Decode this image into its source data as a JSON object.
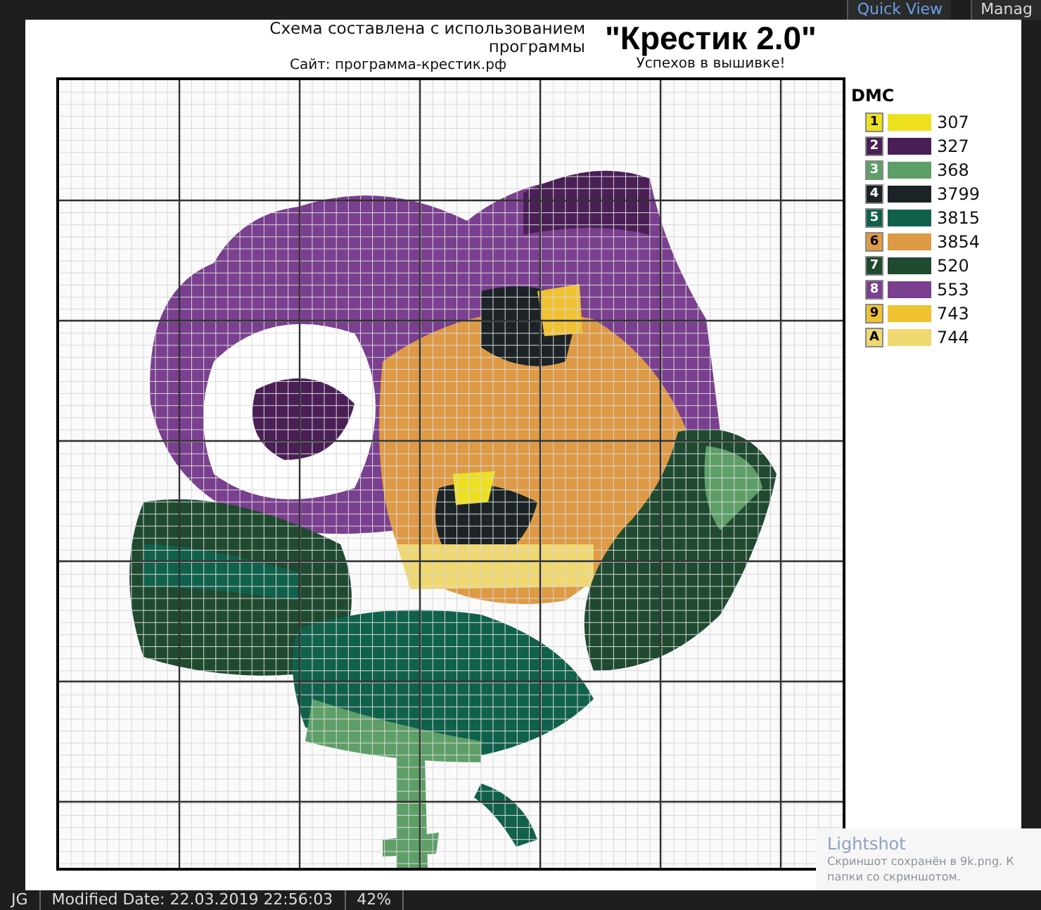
{
  "toolbar": {
    "items": [
      {
        "label": "Quick View"
      },
      {
        "label": "Manag"
      }
    ]
  },
  "header": {
    "caption": "Схема составлена с использованием программы",
    "site": "Сайт: программа-крестик.рф",
    "title": "\"Крестик 2.0\"",
    "slogan": "Успехов в вышивке!"
  },
  "legend": {
    "title": "DMC",
    "items": [
      {
        "symbol": "1",
        "code": "307",
        "color": "#ede11f"
      },
      {
        "symbol": "2",
        "code": "327",
        "color": "#4a1f55"
      },
      {
        "symbol": "3",
        "code": "368",
        "color": "#5e9f68"
      },
      {
        "symbol": "4",
        "code": "3799",
        "color": "#1b2326"
      },
      {
        "symbol": "5",
        "code": "3815",
        "color": "#10614c"
      },
      {
        "symbol": "6",
        "code": "3854",
        "color": "#de9a45"
      },
      {
        "symbol": "7",
        "code": "520",
        "color": "#1f4a30"
      },
      {
        "symbol": "8",
        "code": "553",
        "color": "#7a3f8e"
      },
      {
        "symbol": "9",
        "code": "743",
        "color": "#f0c232"
      },
      {
        "symbol": "A",
        "code": "744",
        "color": "#f0d870"
      }
    ]
  },
  "toast": {
    "title": "Lightshot",
    "lines": [
      "Скриншот сохранён в 9k.png. К",
      "папки со скриншотом."
    ]
  },
  "status_bar": {
    "items": [
      "JG",
      "Modified Date: 22.03.2019 22:56:03",
      "42%"
    ]
  }
}
